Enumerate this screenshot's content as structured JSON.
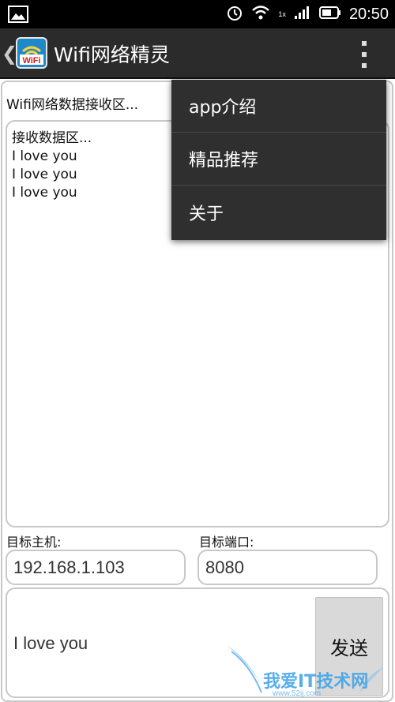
{
  "statusbar": {
    "time": "20:50",
    "signal_label": "1x",
    "icons": [
      "image-icon",
      "alarm-icon",
      "wifi-icon",
      "signal-icon",
      "battery-icon"
    ]
  },
  "actionbar": {
    "back_glyph": "❮",
    "title": "Wifi网络精灵",
    "logo_text": "WiFi"
  },
  "receive": {
    "section_label": "Wifi网络数据接收区...",
    "lines": [
      "接收数据区...",
      "I love you",
      "I love you",
      "I love you"
    ]
  },
  "target": {
    "host_label": "目标主机:",
    "host_value": "192.168.1.103",
    "port_label": "目标端口:",
    "port_value": "8080"
  },
  "send": {
    "text": "I love you",
    "button_label": "发送"
  },
  "menu": {
    "items": [
      "app介绍",
      "精品推荐",
      "关于"
    ]
  },
  "watermark": {
    "text": "我爱IT技术网",
    "url": "www.52ij.com"
  },
  "colors": {
    "actionbar_bg": "#2b2b2b",
    "menu_bg": "#2f2f2f",
    "border": "#c8c8c8",
    "logo_bg": "#1e88c8"
  }
}
